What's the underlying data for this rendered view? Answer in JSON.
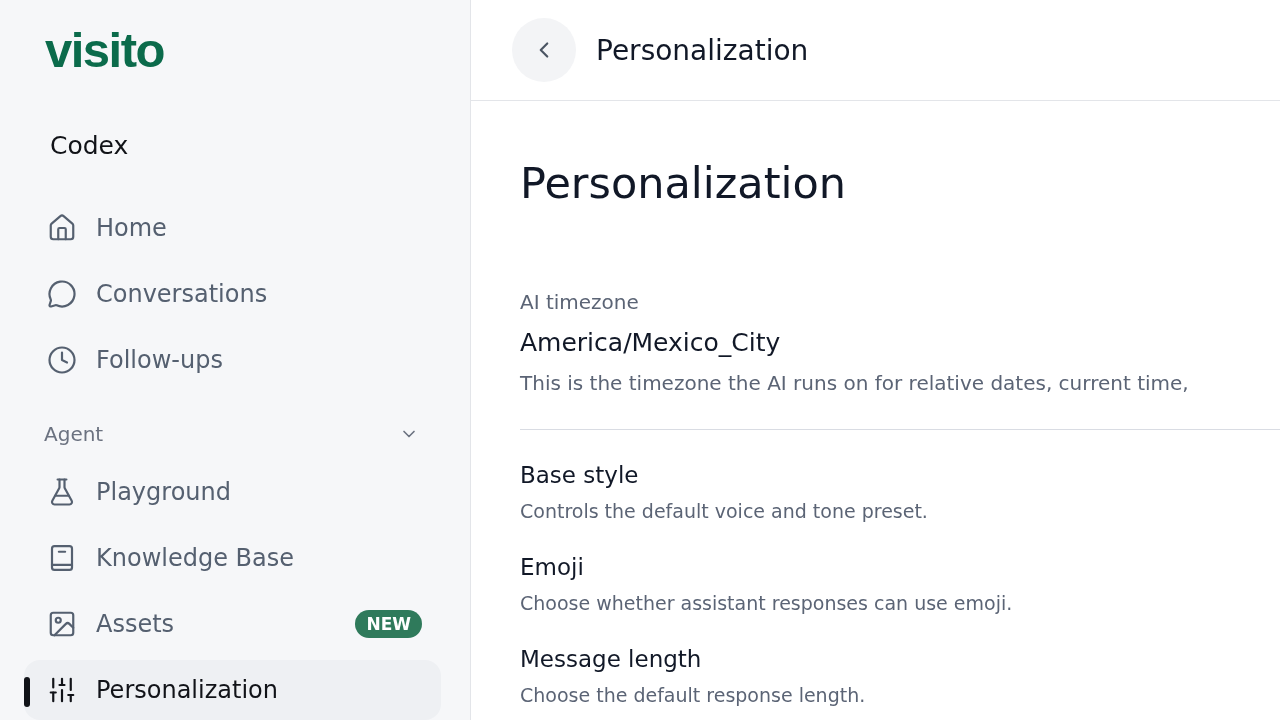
{
  "sidebar": {
    "logo": "visito",
    "workspace": "Codex",
    "items": [
      {
        "label": "Home",
        "selected": false
      },
      {
        "label": "Conversations",
        "selected": false
      },
      {
        "label": "Follow-ups",
        "selected": false
      }
    ],
    "sections": [
      {
        "title": "Agent",
        "expanded": true,
        "items": [
          {
            "label": "Playground",
            "selected": false
          },
          {
            "label": "Knowledge Base",
            "selected": false
          },
          {
            "label": "Assets",
            "badge": "NEW",
            "selected": false
          },
          {
            "label": "Personalization",
            "selected": true
          }
        ]
      }
    ]
  },
  "header": {
    "title": "Personalization"
  },
  "page": {
    "title": "Personalization",
    "timezone": {
      "label": "AI timezone",
      "value": "America/Mexico_City",
      "description": "This is the timezone the AI runs on for relative dates, current time,"
    },
    "settings": [
      {
        "title": "Base style",
        "description": "Controls the default voice and tone preset."
      },
      {
        "title": "Emoji",
        "description": "Choose whether assistant responses can use emoji."
      },
      {
        "title": "Message length",
        "description": "Choose the default response length."
      }
    ]
  }
}
